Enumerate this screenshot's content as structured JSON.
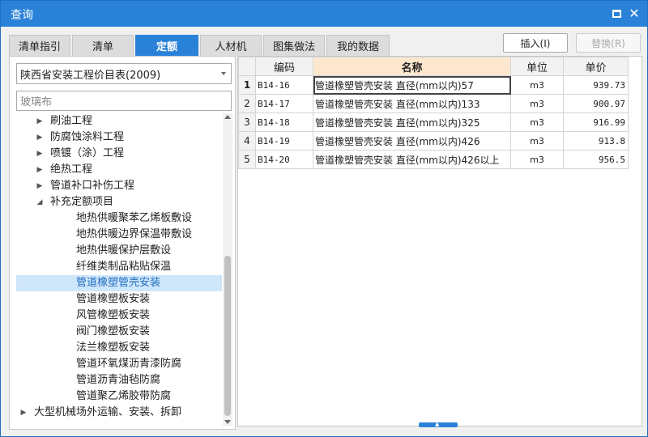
{
  "window": {
    "title": "查询"
  },
  "tabs": [
    {
      "label": "清单指引"
    },
    {
      "label": "清单"
    },
    {
      "label": "定额",
      "active": true
    },
    {
      "label": "人材机"
    },
    {
      "label": "图集做法"
    },
    {
      "label": "我的数据"
    }
  ],
  "actions": {
    "insert_label": "插入(I)",
    "replace_label": "替换(R)"
  },
  "left": {
    "library_select": "陕西省安装工程价目表(2009)",
    "search_value": "玻璃布",
    "tree": [
      {
        "label": "刷油工程",
        "level": 1,
        "caret": "right"
      },
      {
        "label": "防腐蚀涂料工程",
        "level": 1,
        "caret": "right"
      },
      {
        "label": "喷镀（涂）工程",
        "level": 1,
        "caret": "right"
      },
      {
        "label": "绝热工程",
        "level": 1,
        "caret": "right"
      },
      {
        "label": "管道补口补伤工程",
        "level": 1,
        "caret": "right"
      },
      {
        "label": "补充定额项目",
        "level": 1,
        "caret": "down"
      },
      {
        "label": "地热供暖聚苯乙烯板敷设",
        "level": 2
      },
      {
        "label": "地热供暖边界保温带敷设",
        "level": 2
      },
      {
        "label": "地热供暖保护层敷设",
        "level": 2
      },
      {
        "label": "纤维类制品粘贴保温",
        "level": 2
      },
      {
        "label": "管道橡塑管壳安装",
        "level": 2,
        "selected": true
      },
      {
        "label": "管道橡塑板安装",
        "level": 2
      },
      {
        "label": "风管橡塑板安装",
        "level": 2
      },
      {
        "label": "阀门橡塑板安装",
        "level": 2
      },
      {
        "label": "法兰橡塑板安装",
        "level": 2
      },
      {
        "label": "管道环氧煤沥青漆防腐",
        "level": 2
      },
      {
        "label": "管道沥青油毡防腐",
        "level": 2
      },
      {
        "label": "管道聚乙烯胶带防腐",
        "level": 2
      },
      {
        "label": "大型机械场外运输、安装、拆卸",
        "level": 0,
        "caret": "right"
      }
    ]
  },
  "grid": {
    "headers": {
      "code": "编码",
      "name": "名称",
      "unit": "单位",
      "price": "单价"
    },
    "rows": [
      {
        "num": "1",
        "code": "B14-16",
        "name": "管道橡塑管壳安装 直径(mm以内)57",
        "unit": "m3",
        "price": "939.73"
      },
      {
        "num": "2",
        "code": "B14-17",
        "name": "管道橡塑管壳安装 直径(mm以内)133",
        "unit": "m3",
        "price": "900.97"
      },
      {
        "num": "3",
        "code": "B14-18",
        "name": "管道橡塑管壳安装 直径(mm以内)325",
        "unit": "m3",
        "price": "916.99"
      },
      {
        "num": "4",
        "code": "B14-19",
        "name": "管道橡塑管壳安装 直径(mm以内)426",
        "unit": "m3",
        "price": "913.8"
      },
      {
        "num": "5",
        "code": "B14-20",
        "name": "管道橡塑管壳安装 直径(mm以内)426以上",
        "unit": "m3",
        "price": "956.5"
      }
    ]
  },
  "colors": {
    "accent": "#2a82d8",
    "selected_bg": "#cfe6fb",
    "name_header_bg": "#fde8cf"
  },
  "icons": {
    "maximize": "maximize-icon",
    "close": "close-icon"
  }
}
